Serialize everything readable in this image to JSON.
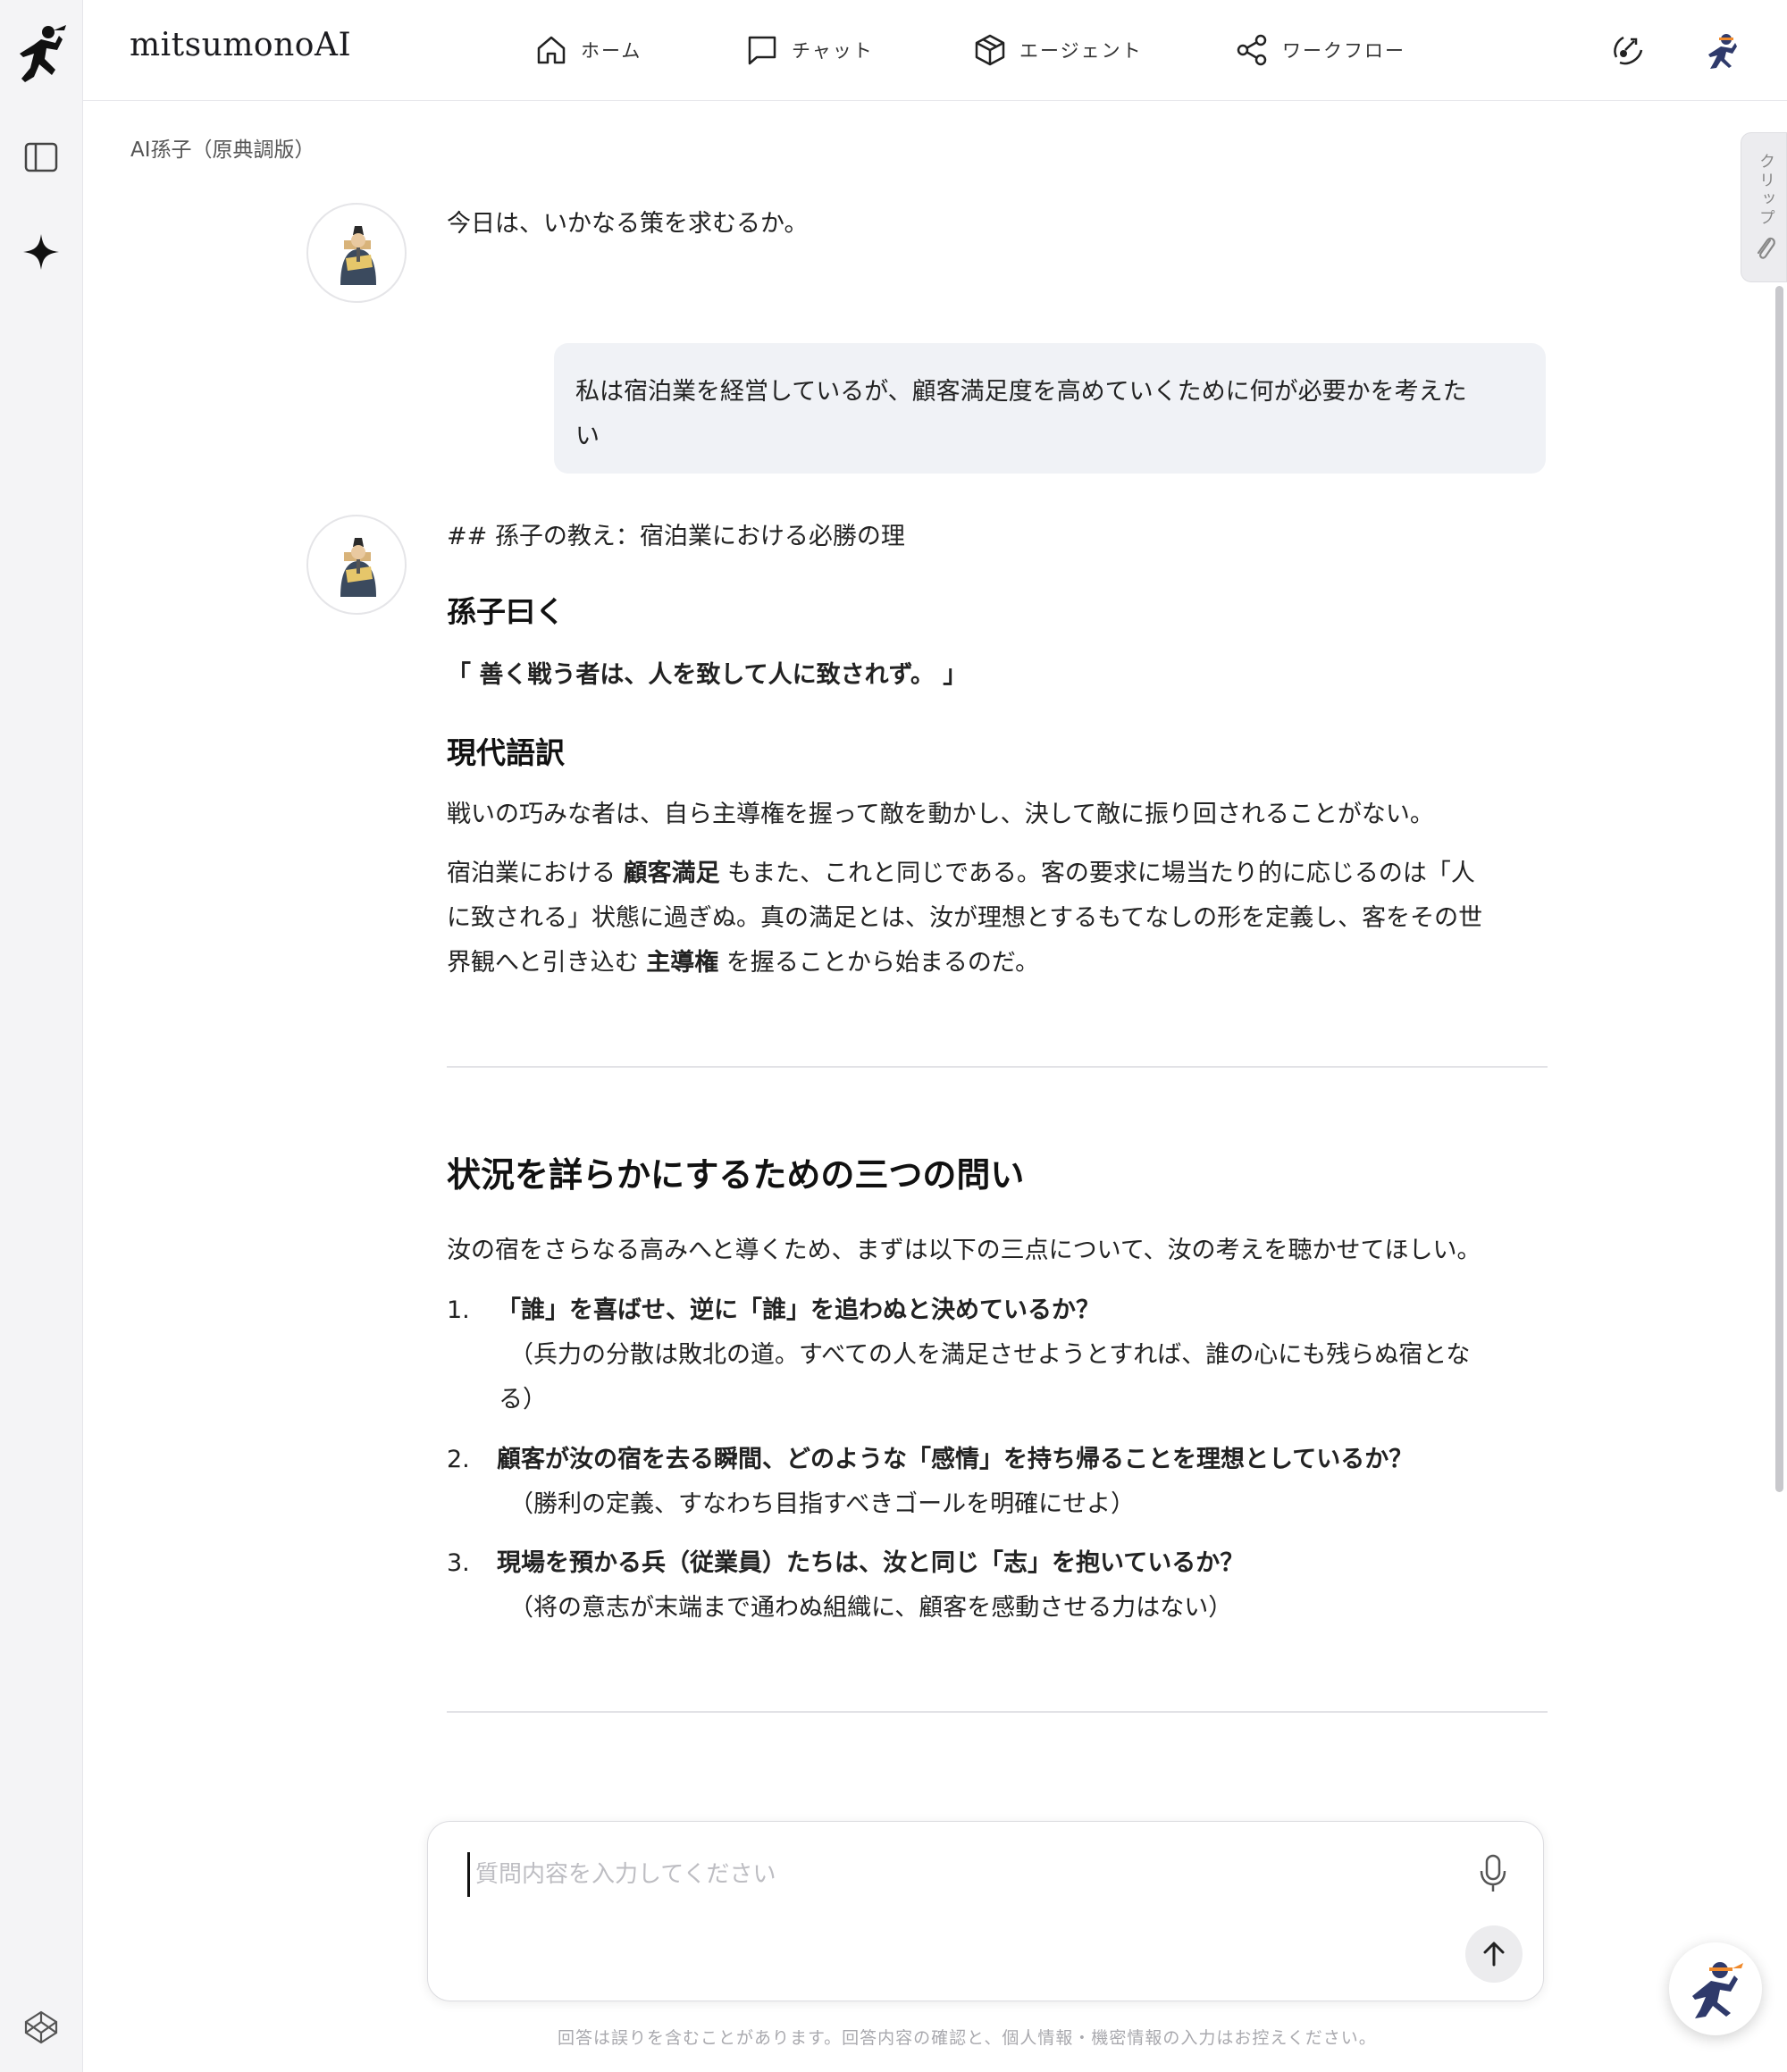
{
  "app": {
    "brand": "mitsumonoAI"
  },
  "nav": [
    {
      "label": "ホーム",
      "icon": "home-icon"
    },
    {
      "label": "チャット",
      "icon": "chat-icon"
    },
    {
      "label": "エージェント",
      "icon": "box-icon"
    },
    {
      "label": "ワークフロー",
      "icon": "share-icon"
    }
  ],
  "breadcrumb": "AI孫子（原典調版）",
  "clip_tab": "クリップ",
  "messages": {
    "greeting": "今日は、いかなる策を求むるか。",
    "user_line1": "私は宿泊業を経営しているが、顧客満足度を高めていくために何が必要かを考えた",
    "user_line2": "い",
    "answer": {
      "md_heading": "## 孫子の教え：宿泊業における必勝の理",
      "h_sonshi": "孫子曰く",
      "quote": "「 善く戦う者は、人を致して人に致されず。 」",
      "h_modern": "現代語訳",
      "p1": "戦いの巧みな者は、自ら主導権を握って敵を動かし、決して敵に振り回されることがない。",
      "p2_a": "宿泊業における ",
      "p2_b": "顧客満足",
      "p2_c": " もまた、これと同じである。客の要求に場当たり的に応じるのは「人",
      "p2_line2": "に致される」状態に過ぎぬ。真の満足とは、汝が理想とするもてなしの形を定義し、客をその世",
      "p2_line3a": "界観へと引き込む ",
      "p2_line3b": "主導権",
      "p2_line3c": " を握ることから始まるのだ。",
      "h_questions": "状況を詳らかにするための三つの問い",
      "intro": "汝の宿をさらなる高みへと導くため、まずは以下の三点について、汝の考えを聴かせてほしい。",
      "items": [
        {
          "num": "1.",
          "title": "「誰」を喜ばせ、逆に「誰」を追わぬと決めているか？",
          "note1": "（兵力の分散は敗北の道。すべての人を満足させようとすれば、誰の心にも残らぬ宿とな",
          "note2": "る）"
        },
        {
          "num": "2.",
          "title": "顧客が汝の宿を去る瞬間、どのような「感情」を持ち帰ることを理想としているか？",
          "note1": "（勝利の定義、すなわち目指すべきゴールを明確にせよ）",
          "note2": ""
        },
        {
          "num": "3.",
          "title": "現場を預かる兵（従業員）たちは、汝と同じ「志」を抱いているか？",
          "note1": "（将の意志が末端まで通わぬ組織に、顧客を感動させる力はない）",
          "note2": ""
        }
      ]
    }
  },
  "input": {
    "placeholder": "質問内容を入力してください"
  },
  "disclaimer": "回答は誤りを含むことがあります。回答内容の確認と、個人情報・機密情報の入力はお控えください。",
  "colors": {
    "accent_navy": "#2f3a6b",
    "accent_orange": "#f08a2c",
    "bubble": "#f0f2f6"
  }
}
